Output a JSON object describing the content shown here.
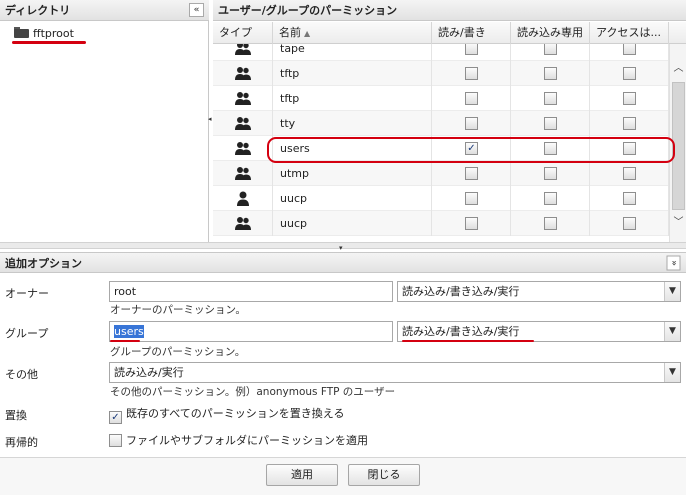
{
  "directory": {
    "title": "ディレクトリ",
    "collapse_icon": "«",
    "root_folder": "fftproot"
  },
  "permissions": {
    "title": "ユーザー/グループのパーミッション",
    "columns": [
      "タイプ",
      "名前",
      "読み/書き",
      "読み込み専用",
      "アクセスは..."
    ],
    "sort_indicator": "▲",
    "rows": [
      {
        "type": "group",
        "name": "tape",
        "read_write": false,
        "read_only": false,
        "access": false
      },
      {
        "type": "group",
        "name": "tftp",
        "read_write": false,
        "read_only": false,
        "access": false
      },
      {
        "type": "group",
        "name": "tftp",
        "read_write": false,
        "read_only": false,
        "access": false
      },
      {
        "type": "group",
        "name": "tty",
        "read_write": false,
        "read_only": false,
        "access": false
      },
      {
        "type": "group",
        "name": "users",
        "read_write": true,
        "read_only": false,
        "access": false
      },
      {
        "type": "group",
        "name": "utmp",
        "read_write": false,
        "read_only": false,
        "access": false
      },
      {
        "type": "user",
        "name": "uucp",
        "read_write": false,
        "read_only": false,
        "access": false
      },
      {
        "type": "group",
        "name": "uucp",
        "read_write": false,
        "read_only": false,
        "access": false
      }
    ]
  },
  "options": {
    "title": "追加オプション",
    "expand_icon": "»",
    "owner_label": "オーナー",
    "owner_value": "root",
    "owner_perm": "読み込み/書き込み/実行",
    "owner_hint": "オーナーのパーミッション。",
    "group_label": "グループ",
    "group_value": "users",
    "group_perm": "読み込み/書き込み/実行",
    "group_hint": "グループのパーミッション。",
    "other_label": "その他",
    "other_perm": "読み込み/実行",
    "other_hint": "その他のパーミッション。例）anonymous FTP のユーザー",
    "replace_label": "置換",
    "replace_text": "既存のすべてのパーミッションを置き換える",
    "replace_checked": true,
    "recursive_label": "再帰的",
    "recursive_text": "ファイルやサブフォルダにパーミッションを適用",
    "recursive_checked": false
  },
  "buttons": {
    "apply": "適用",
    "close": "閉じる"
  },
  "colors": {
    "annotation_red": "#d40010",
    "selection_blue": "#3875d7"
  }
}
